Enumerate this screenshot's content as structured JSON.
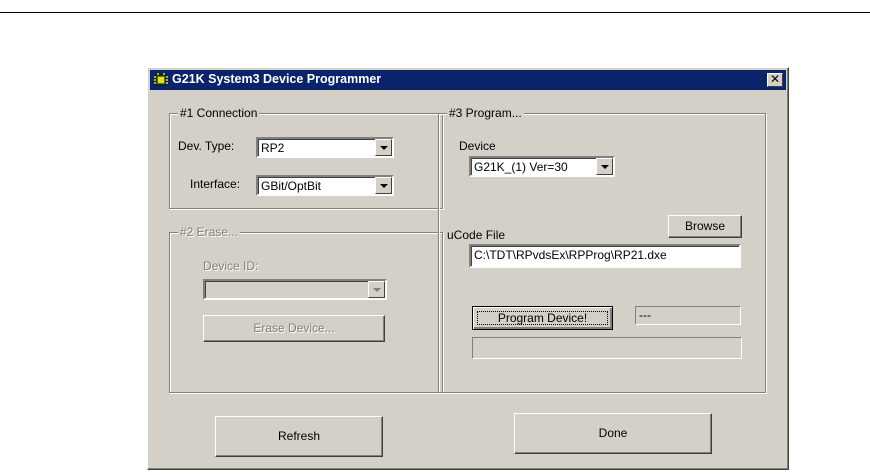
{
  "window": {
    "title": "G21K  System3 Device Programmer",
    "close_glyph": "✕"
  },
  "connection": {
    "legend": "#1 Connection",
    "dev_type_label": "Dev. Type:",
    "dev_type_value": "RP2",
    "interface_label": "Interface:",
    "interface_value": "GBit/OptBit"
  },
  "erase": {
    "legend": "#2 Erase...",
    "device_id_label": "Device ID:",
    "device_id_value": "",
    "erase_button": "Erase Device..."
  },
  "program": {
    "legend": "#3 Program...",
    "device_label": "Device",
    "device_value": "G21K_(1)  Ver=30",
    "ucode_label": "uCode File",
    "browse_button": "Browse",
    "ucode_path": "C:\\TDT\\RPvdsEx\\RPProg\\RP21.dxe",
    "program_button": "Program Device!",
    "status_text": "---",
    "progress_text": ""
  },
  "footer": {
    "refresh_button": "Refresh",
    "done_button": "Done"
  },
  "icons": {
    "title_icon": "chip-icon",
    "dropdown": "chevron-down-icon"
  },
  "colors": {
    "titlebar": "#0a246a",
    "face": "#d4d0c8"
  }
}
